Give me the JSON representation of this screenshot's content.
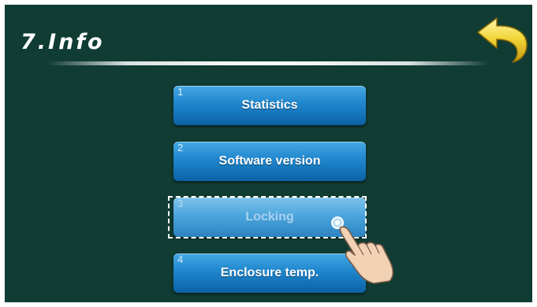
{
  "header": {
    "title": "7.Info"
  },
  "menu": {
    "items": [
      {
        "number": "1",
        "label": "Statistics"
      },
      {
        "number": "2",
        "label": "Software version"
      },
      {
        "number": "3",
        "label": "Locking"
      },
      {
        "number": "4",
        "label": "Enclosure temp."
      }
    ]
  },
  "colors": {
    "background": "#103c34",
    "button": "#1f86cd",
    "back_arrow": "#f2d63a"
  },
  "icons": {
    "back": "back-arrow-icon",
    "touch": "touch-hand-icon"
  }
}
